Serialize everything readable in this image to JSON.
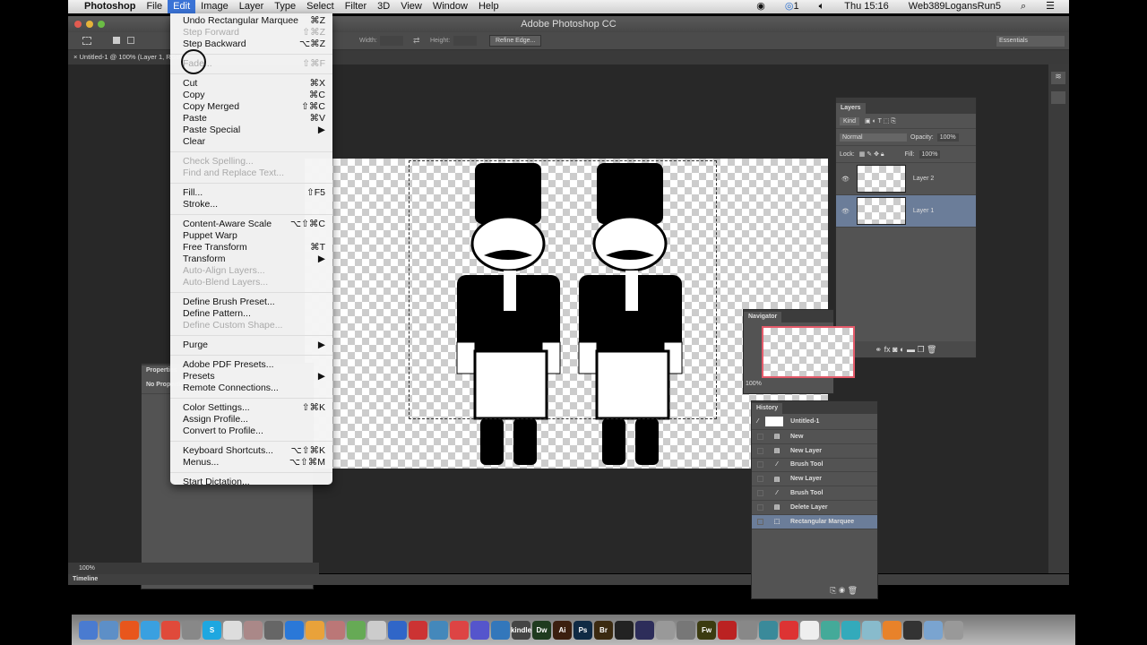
{
  "menubar": {
    "apple": "",
    "app": "Photoshop",
    "items": [
      "File",
      "Edit",
      "Image",
      "Layer",
      "Type",
      "Select",
      "Filter",
      "3D",
      "View",
      "Window",
      "Help"
    ],
    "status": {
      "cc_count": "1",
      "clock": "Thu 15:16",
      "user": "Web389LogansRun5"
    }
  },
  "window": {
    "title": "Adobe Photoshop CC",
    "doc_tab": "Untitled-1 @ 100% (Layer 1, RGB/8)",
    "zoom": "100%"
  },
  "options": {
    "width_label": "Width:",
    "height_label": "Height:",
    "refine_edge": "Refine Edge...",
    "workspace": "Essentials"
  },
  "edit_menu": [
    [
      {
        "label": "Undo Rectangular Marquee",
        "shortcut": "⌘Z"
      },
      {
        "label": "Step Forward",
        "shortcut": "⇧⌘Z",
        "disabled": true
      },
      {
        "label": "Step Backward",
        "shortcut": "⌥⌘Z"
      }
    ],
    [
      {
        "label": "Fade...",
        "shortcut": "⇧⌘F",
        "disabled": true
      }
    ],
    [
      {
        "label": "Cut",
        "shortcut": "⌘X"
      },
      {
        "label": "Copy",
        "shortcut": "⌘C"
      },
      {
        "label": "Copy Merged",
        "shortcut": "⇧⌘C"
      },
      {
        "label": "Paste",
        "shortcut": "⌘V"
      },
      {
        "label": "Paste Special",
        "shortcut": "▶"
      },
      {
        "label": "Clear",
        "shortcut": ""
      }
    ],
    [
      {
        "label": "Check Spelling...",
        "shortcut": "",
        "disabled": true
      },
      {
        "label": "Find and Replace Text...",
        "shortcut": "",
        "disabled": true
      }
    ],
    [
      {
        "label": "Fill...",
        "shortcut": "⇧F5"
      },
      {
        "label": "Stroke...",
        "shortcut": ""
      }
    ],
    [
      {
        "label": "Content-Aware Scale",
        "shortcut": "⌥⇧⌘C"
      },
      {
        "label": "Puppet Warp",
        "shortcut": ""
      },
      {
        "label": "Free Transform",
        "shortcut": "⌘T"
      },
      {
        "label": "Transform",
        "shortcut": "▶"
      },
      {
        "label": "Auto-Align Layers...",
        "shortcut": "",
        "disabled": true
      },
      {
        "label": "Auto-Blend Layers...",
        "shortcut": "",
        "disabled": true
      }
    ],
    [
      {
        "label": "Define Brush Preset...",
        "shortcut": ""
      },
      {
        "label": "Define Pattern...",
        "shortcut": ""
      },
      {
        "label": "Define Custom Shape...",
        "shortcut": "",
        "disabled": true
      }
    ],
    [
      {
        "label": "Purge",
        "shortcut": "▶"
      }
    ],
    [
      {
        "label": "Adobe PDF Presets...",
        "shortcut": ""
      },
      {
        "label": "Presets",
        "shortcut": "▶"
      },
      {
        "label": "Remote Connections...",
        "shortcut": ""
      }
    ],
    [
      {
        "label": "Color Settings...",
        "shortcut": "⇧⌘K"
      },
      {
        "label": "Assign Profile...",
        "shortcut": ""
      },
      {
        "label": "Convert to Profile...",
        "shortcut": ""
      }
    ],
    [
      {
        "label": "Keyboard Shortcuts...",
        "shortcut": "⌥⇧⌘K"
      },
      {
        "label": "Menus...",
        "shortcut": "⌥⇧⌘M"
      }
    ],
    [
      {
        "label": "Start Dictation...",
        "shortcut": ""
      }
    ]
  ],
  "layers": {
    "title": "Layers",
    "kind": "Kind",
    "blend": "Normal",
    "opacity_label": "Opacity:",
    "opacity": "100%",
    "lock_label": "Lock:",
    "fill_label": "Fill:",
    "fill": "100%",
    "items": [
      {
        "name": "Layer 2",
        "selected": false
      },
      {
        "name": "Layer 1",
        "selected": true
      }
    ]
  },
  "navigator": {
    "title": "Navigator",
    "zoom": "100%"
  },
  "properties": {
    "title": "Properties",
    "body": "No Properties"
  },
  "history": {
    "title": "History",
    "snapshot": "Untitled-1",
    "items": [
      {
        "name": "New",
        "icon": "document-icon"
      },
      {
        "name": "New Layer",
        "icon": "document-icon"
      },
      {
        "name": "Brush Tool",
        "icon": "brush-icon"
      },
      {
        "name": "New Layer",
        "icon": "document-icon"
      },
      {
        "name": "Brush Tool",
        "icon": "brush-icon"
      },
      {
        "name": "Delete Layer",
        "icon": "document-icon"
      },
      {
        "name": "Rectangular Marquee",
        "icon": "marquee-icon",
        "selected": true
      }
    ]
  },
  "timeline": {
    "title": "Timeline"
  },
  "dock": {
    "items": [
      {
        "label": "",
        "color": "#4a7bd0"
      },
      {
        "label": "",
        "color": "#5d8fc7"
      },
      {
        "label": "",
        "color": "#e8561c"
      },
      {
        "label": "",
        "color": "#3aa0e0"
      },
      {
        "label": "",
        "color": "#e04a3a"
      },
      {
        "label": "",
        "color": "#888"
      },
      {
        "label": "S",
        "color": "#1ea7e0"
      },
      {
        "label": "",
        "color": "#ddd"
      },
      {
        "label": "",
        "color": "#a88"
      },
      {
        "label": "",
        "color": "#666"
      },
      {
        "label": "",
        "color": "#2a78d8"
      },
      {
        "label": "",
        "color": "#e9a23a"
      },
      {
        "label": "",
        "color": "#b77"
      },
      {
        "label": "",
        "color": "#6a5"
      },
      {
        "label": "",
        "color": "#ccc"
      },
      {
        "label": "",
        "color": "#3066c8"
      },
      {
        "label": "",
        "color": "#c33"
      },
      {
        "label": "",
        "color": "#48b"
      },
      {
        "label": "",
        "color": "#d44"
      },
      {
        "label": "",
        "color": "#55c"
      },
      {
        "label": "",
        "color": "#37b"
      },
      {
        "label": "kindle",
        "color": "#444"
      },
      {
        "label": "Dw",
        "color": "#1f3b1f"
      },
      {
        "label": "Ai",
        "color": "#3b1f0f"
      },
      {
        "label": "Ps",
        "color": "#0f2a44"
      },
      {
        "label": "Br",
        "color": "#3b2a10"
      },
      {
        "label": "",
        "color": "#222"
      },
      {
        "label": "",
        "color": "#2d2d5a"
      },
      {
        "label": "",
        "color": "#999"
      },
      {
        "label": "",
        "color": "#777"
      },
      {
        "label": "Fw",
        "color": "#3b3b10"
      },
      {
        "label": "",
        "color": "#b22"
      },
      {
        "label": "",
        "color": "#888"
      },
      {
        "label": "",
        "color": "#3a8a9a"
      },
      {
        "label": "",
        "color": "#d33"
      },
      {
        "label": "",
        "color": "#eee"
      },
      {
        "label": "",
        "color": "#4a9"
      },
      {
        "label": "",
        "color": "#3ab"
      },
      {
        "label": "",
        "color": "#8bc"
      },
      {
        "label": "",
        "color": "#e8822a"
      },
      {
        "label": "",
        "color": "#333"
      },
      {
        "label": "",
        "color": "#7aa4d0"
      },
      {
        "label": "",
        "color": "#999"
      }
    ]
  }
}
